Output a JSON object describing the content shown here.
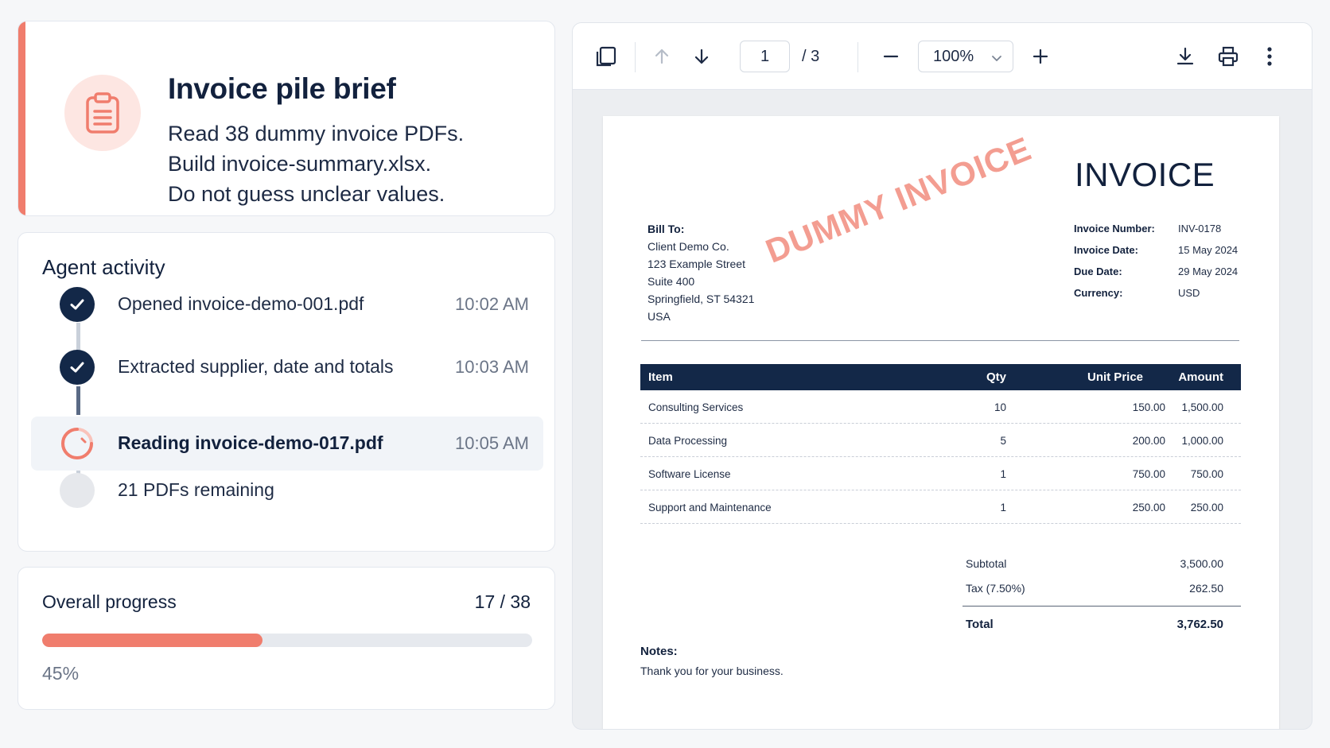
{
  "brief": {
    "icon": "clipboard-icon",
    "title": "Invoice pile brief",
    "lines": [
      "Read 38 dummy invoice PDFs.",
      "Build invoice-summary.xlsx.",
      "Do not guess unclear values."
    ]
  },
  "activity": {
    "heading": "Agent activity",
    "items": [
      {
        "status": "done",
        "text": "Opened invoice-demo-001.pdf",
        "time": "10:02 AM"
      },
      {
        "status": "done",
        "text": "Extracted supplier, date and totals",
        "time": "10:03 AM"
      },
      {
        "status": "in-progress",
        "text": "Reading invoice-demo-017.pdf",
        "time": "10:05 AM"
      },
      {
        "status": "pending",
        "text": "21 PDFs remaining",
        "time": ""
      }
    ]
  },
  "progress": {
    "label": "Overall progress",
    "count": "17 / 38",
    "percent_label": "45%",
    "fraction": 0.45
  },
  "viewer": {
    "toolbar": {
      "page_value": "1",
      "page_total": "/ 3",
      "zoom": "100%"
    },
    "document": {
      "title": "INVOICE",
      "watermark": "DUMMY INVOICE",
      "bill_to_label": "Bill To:",
      "bill_to": [
        "Client Demo Co.",
        "123 Example Street",
        "Suite 400",
        "Springfield, ST 54321",
        "USA"
      ],
      "meta": [
        {
          "label": "Invoice Number:",
          "value": "INV-0178"
        },
        {
          "label": "Invoice Date:",
          "value": "15 May 2024"
        },
        {
          "label": "Due Date:",
          "value": "29 May 2024"
        },
        {
          "label": "Currency:",
          "value": "USD"
        }
      ],
      "table": {
        "headers": {
          "item": "Item",
          "qty": "Qty",
          "unit_price": "Unit Price",
          "amount": "Amount"
        },
        "rows": [
          {
            "item": "Consulting Services",
            "qty": "10",
            "unit_price": "150.00",
            "amount": "1,500.00"
          },
          {
            "item": "Data Processing",
            "qty": "5",
            "unit_price": "200.00",
            "amount": "1,000.00"
          },
          {
            "item": "Software License",
            "qty": "1",
            "unit_price": "750.00",
            "amount": "750.00"
          },
          {
            "item": "Support and Maintenance",
            "qty": "1",
            "unit_price": "250.00",
            "amount": "250.00"
          }
        ]
      },
      "totals": {
        "subtotal_label": "Subtotal",
        "subtotal": "3,500.00",
        "tax_label": "Tax (7.50%)",
        "tax": "262.50",
        "total_label": "Total",
        "total": "3,762.50"
      },
      "notes_label": "Notes:",
      "notes": "Thank you for your business."
    }
  },
  "colors": {
    "accent": "#f07d6d",
    "navy": "#132848",
    "muted": "#6b7587"
  }
}
